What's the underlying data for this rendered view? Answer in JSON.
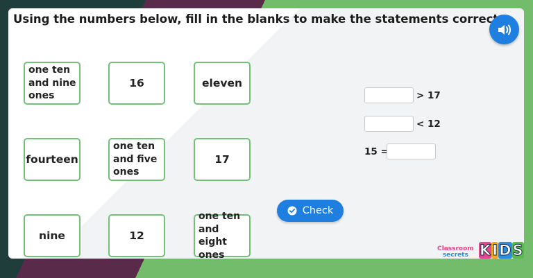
{
  "instruction": "Using the numbers below, fill in the blanks to make the statements correct.",
  "audio_icon": "speaker-icon",
  "tiles": [
    {
      "label": "one ten and nine ones",
      "lines": [
        "one ten",
        "and nine",
        "ones"
      ]
    },
    {
      "label": "16"
    },
    {
      "label": "eleven"
    },
    {
      "label": "fourteen"
    },
    {
      "label": "one ten and five ones",
      "lines": [
        "one ten",
        "and five",
        "ones"
      ]
    },
    {
      "label": "17"
    },
    {
      "label": "nine"
    },
    {
      "label": "12"
    },
    {
      "label": "one ten and eight ones",
      "lines": [
        "one ten",
        "and eight",
        "ones"
      ]
    }
  ],
  "statements": [
    {
      "before": "",
      "blank_value": "",
      "after": "> 17"
    },
    {
      "before": "",
      "blank_value": "",
      "after": "< 12"
    },
    {
      "before": "15 =",
      "blank_value": "",
      "after": ""
    }
  ],
  "check_button": {
    "label": "Check",
    "icon": "check-circle-icon"
  },
  "logo": {
    "classroom": "Classroom",
    "secrets": "secrets",
    "kids": [
      "K",
      "I",
      "D",
      "S"
    ]
  },
  "colors": {
    "accent": "#1f7fe0",
    "tile_border": "#74c07a",
    "frame": "#72bc6c"
  }
}
